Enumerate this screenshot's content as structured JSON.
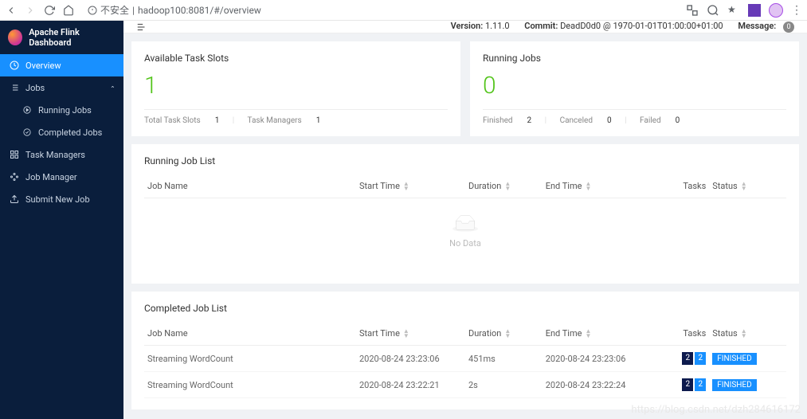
{
  "browser": {
    "insecure_label": "不安全",
    "url": "hadoop100:8081/#/overview"
  },
  "app_title": "Apache Flink Dashboard",
  "sidebar": {
    "overview": "Overview",
    "jobs": "Jobs",
    "running_jobs": "Running Jobs",
    "completed_jobs": "Completed Jobs",
    "task_managers": "Task Managers",
    "job_manager": "Job Manager",
    "submit_new_job": "Submit New Job"
  },
  "topbar": {
    "version_label": "Version:",
    "version_value": "1.11.0",
    "commit_label": "Commit:",
    "commit_value": "DeadD0d0 @ 1970-01-01T01:00:00+01:00",
    "message_label": "Message:",
    "message_count": "0"
  },
  "slots_card": {
    "title": "Available Task Slots",
    "value": "1",
    "total_label": "Total Task Slots",
    "total_value": "1",
    "tm_label": "Task Managers",
    "tm_value": "1"
  },
  "running_card": {
    "title": "Running Jobs",
    "value": "0",
    "finished_label": "Finished",
    "finished_value": "2",
    "canceled_label": "Canceled",
    "canceled_value": "0",
    "failed_label": "Failed",
    "failed_value": "0"
  },
  "columns": {
    "job_name": "Job Name",
    "start_time": "Start Time",
    "duration": "Duration",
    "end_time": "End Time",
    "tasks": "Tasks",
    "status": "Status"
  },
  "running_list": {
    "title": "Running Job List",
    "empty_text": "No Data"
  },
  "completed_list": {
    "title": "Completed Job List",
    "rows": [
      {
        "name": "Streaming WordCount",
        "start": "2020-08-24 23:23:06",
        "duration": "451ms",
        "end": "2020-08-24 23:23:06",
        "task_a": "2",
        "task_b": "2",
        "status": "FINISHED"
      },
      {
        "name": "Streaming WordCount",
        "start": "2020-08-24 23:22:21",
        "duration": "2s",
        "end": "2020-08-24 23:22:24",
        "task_a": "2",
        "task_b": "2",
        "status": "FINISHED"
      }
    ]
  },
  "watermark": "https://blog.csdn.net/dzh284616172"
}
